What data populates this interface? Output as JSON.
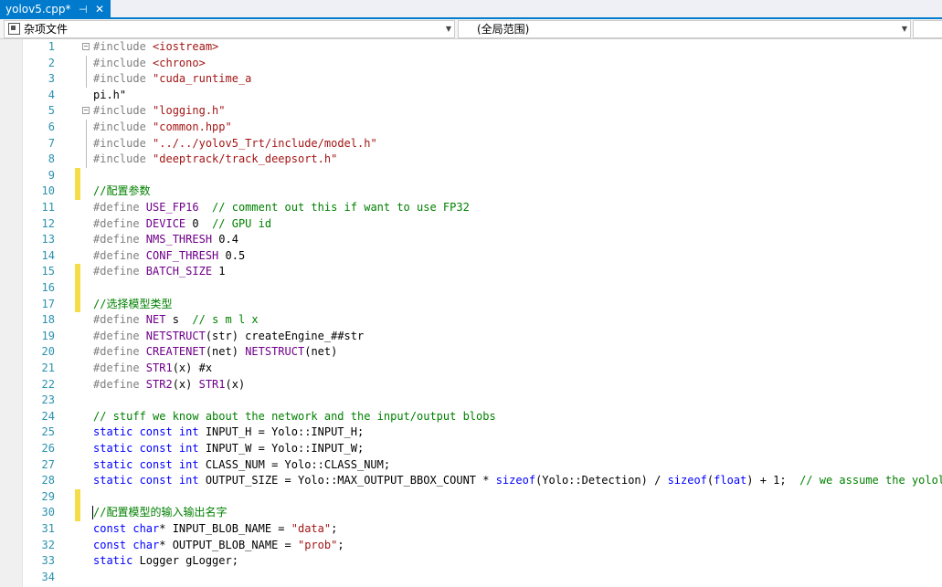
{
  "tab": {
    "title": "yolov5.cpp*",
    "pin": "⊣",
    "close": "✕"
  },
  "navbar": {
    "project": "杂项文件",
    "scope": "(全局范围)",
    "member": ""
  },
  "lines": [
    {
      "n": "1",
      "fold": "minus",
      "chg": false,
      "segs": [
        [
          "p",
          "#include "
        ],
        [
          "s",
          "<iostream>"
        ]
      ]
    },
    {
      "n": "2",
      "fold": "guide",
      "chg": false,
      "segs": [
        [
          "p",
          "#include "
        ],
        [
          "s",
          "<chrono>"
        ]
      ]
    },
    {
      "n": "3",
      "fold": "guide",
      "chg": false,
      "segs": [
        [
          "p",
          "#include "
        ],
        [
          "s",
          "\"cuda_runtime_a"
        ]
      ]
    },
    {
      "n": "4",
      "fold": "",
      "chg": false,
      "segs": [
        [
          "t",
          "pi.h\""
        ]
      ]
    },
    {
      "n": "5",
      "fold": "minus",
      "chg": false,
      "segs": [
        [
          "p",
          "#include "
        ],
        [
          "s",
          "\"logging.h\""
        ]
      ]
    },
    {
      "n": "6",
      "fold": "guide",
      "chg": false,
      "segs": [
        [
          "p",
          "#include "
        ],
        [
          "s",
          "\"common.hpp\""
        ]
      ]
    },
    {
      "n": "7",
      "fold": "guide",
      "chg": false,
      "segs": [
        [
          "p",
          "#include "
        ],
        [
          "s",
          "\"../../yolov5_Trt/include/model.h\""
        ]
      ]
    },
    {
      "n": "8",
      "fold": "guide",
      "chg": false,
      "segs": [
        [
          "p",
          "#include "
        ],
        [
          "s",
          "\"deeptrack/track_deepsort.h\""
        ]
      ]
    },
    {
      "n": "9",
      "fold": "",
      "chg": true,
      "segs": []
    },
    {
      "n": "10",
      "fold": "",
      "chg": true,
      "segs": [
        [
          "c",
          "//配置参数"
        ]
      ]
    },
    {
      "n": "11",
      "fold": "",
      "chg": false,
      "segs": [
        [
          "p",
          "#define "
        ],
        [
          "m",
          "USE_FP16"
        ],
        [
          "t",
          "  "
        ],
        [
          "c",
          "// comment out this if want to use FP32"
        ]
      ]
    },
    {
      "n": "12",
      "fold": "",
      "chg": false,
      "segs": [
        [
          "p",
          "#define "
        ],
        [
          "m",
          "DEVICE"
        ],
        [
          "t",
          " 0  "
        ],
        [
          "c",
          "// GPU id"
        ]
      ]
    },
    {
      "n": "13",
      "fold": "",
      "chg": false,
      "segs": [
        [
          "p",
          "#define "
        ],
        [
          "m",
          "NMS_THRESH"
        ],
        [
          "t",
          " 0.4"
        ]
      ]
    },
    {
      "n": "14",
      "fold": "",
      "chg": false,
      "segs": [
        [
          "p",
          "#define "
        ],
        [
          "m",
          "CONF_THRESH"
        ],
        [
          "t",
          " 0.5"
        ]
      ]
    },
    {
      "n": "15",
      "fold": "",
      "chg": true,
      "segs": [
        [
          "p",
          "#define "
        ],
        [
          "m",
          "BATCH_SIZE"
        ],
        [
          "t",
          " 1"
        ]
      ]
    },
    {
      "n": "16",
      "fold": "",
      "chg": true,
      "segs": []
    },
    {
      "n": "17",
      "fold": "",
      "chg": true,
      "segs": [
        [
          "c",
          "//选择模型类型"
        ]
      ]
    },
    {
      "n": "18",
      "fold": "",
      "chg": false,
      "segs": [
        [
          "p",
          "#define "
        ],
        [
          "m",
          "NET"
        ],
        [
          "t",
          " s  "
        ],
        [
          "c",
          "// s m l x"
        ]
      ]
    },
    {
      "n": "19",
      "fold": "",
      "chg": false,
      "segs": [
        [
          "p",
          "#define "
        ],
        [
          "m",
          "NETSTRUCT"
        ],
        [
          "t",
          "(str) createEngine_##str"
        ]
      ]
    },
    {
      "n": "20",
      "fold": "",
      "chg": false,
      "segs": [
        [
          "p",
          "#define "
        ],
        [
          "m",
          "CREATENET"
        ],
        [
          "t",
          "(net) "
        ],
        [
          "m",
          "NETSTRUCT"
        ],
        [
          "t",
          "(net)"
        ]
      ]
    },
    {
      "n": "21",
      "fold": "",
      "chg": false,
      "segs": [
        [
          "p",
          "#define "
        ],
        [
          "m",
          "STR1"
        ],
        [
          "t",
          "(x) #x"
        ]
      ]
    },
    {
      "n": "22",
      "fold": "",
      "chg": false,
      "segs": [
        [
          "p",
          "#define "
        ],
        [
          "m",
          "STR2"
        ],
        [
          "t",
          "(x) "
        ],
        [
          "m",
          "STR1"
        ],
        [
          "t",
          "(x)"
        ]
      ]
    },
    {
      "n": "23",
      "fold": "",
      "chg": false,
      "segs": []
    },
    {
      "n": "24",
      "fold": "",
      "chg": false,
      "segs": [
        [
          "c",
          "// stuff we know about the network and the input/output blobs"
        ]
      ]
    },
    {
      "n": "25",
      "fold": "",
      "chg": false,
      "segs": [
        [
          "k",
          "static const int"
        ],
        [
          "t",
          " INPUT_H = Yolo::INPUT_H;"
        ]
      ]
    },
    {
      "n": "26",
      "fold": "",
      "chg": false,
      "segs": [
        [
          "k",
          "static const int"
        ],
        [
          "t",
          " INPUT_W = Yolo::INPUT_W;"
        ]
      ]
    },
    {
      "n": "27",
      "fold": "",
      "chg": false,
      "segs": [
        [
          "k",
          "static const int"
        ],
        [
          "t",
          " CLASS_NUM = Yolo::CLASS_NUM;"
        ]
      ]
    },
    {
      "n": "28",
      "fold": "",
      "chg": false,
      "segs": [
        [
          "k",
          "static const int"
        ],
        [
          "t",
          " OUTPUT_SIZE = Yolo::MAX_OUTPUT_BBOX_COUNT * "
        ],
        [
          "k",
          "sizeof"
        ],
        [
          "t",
          "(Yolo::Detection) / "
        ],
        [
          "k",
          "sizeof"
        ],
        [
          "t",
          "("
        ],
        [
          "k",
          "float"
        ],
        [
          "t",
          ") + 1;  "
        ],
        [
          "c",
          "// we assume the yololayer"
        ]
      ]
    },
    {
      "n": "29",
      "fold": "",
      "chg": true,
      "segs": []
    },
    {
      "n": "30",
      "fold": "",
      "chg": true,
      "caret": true,
      "segs": [
        [
          "c",
          "//配置模型的输入输出名字"
        ]
      ]
    },
    {
      "n": "31",
      "fold": "",
      "chg": false,
      "segs": [
        [
          "k",
          "const char"
        ],
        [
          "t",
          "* INPUT_BLOB_NAME = "
        ],
        [
          "s",
          "\"data\""
        ],
        [
          "t",
          ";"
        ]
      ]
    },
    {
      "n": "32",
      "fold": "",
      "chg": false,
      "segs": [
        [
          "k",
          "const char"
        ],
        [
          "t",
          "* OUTPUT_BLOB_NAME = "
        ],
        [
          "s",
          "\"prob\""
        ],
        [
          "t",
          ";"
        ]
      ]
    },
    {
      "n": "33",
      "fold": "",
      "chg": false,
      "segs": [
        [
          "k",
          "static"
        ],
        [
          "t",
          " Logger gLogger;"
        ]
      ]
    },
    {
      "n": "34",
      "fold": "",
      "chg": false,
      "segs": []
    }
  ]
}
